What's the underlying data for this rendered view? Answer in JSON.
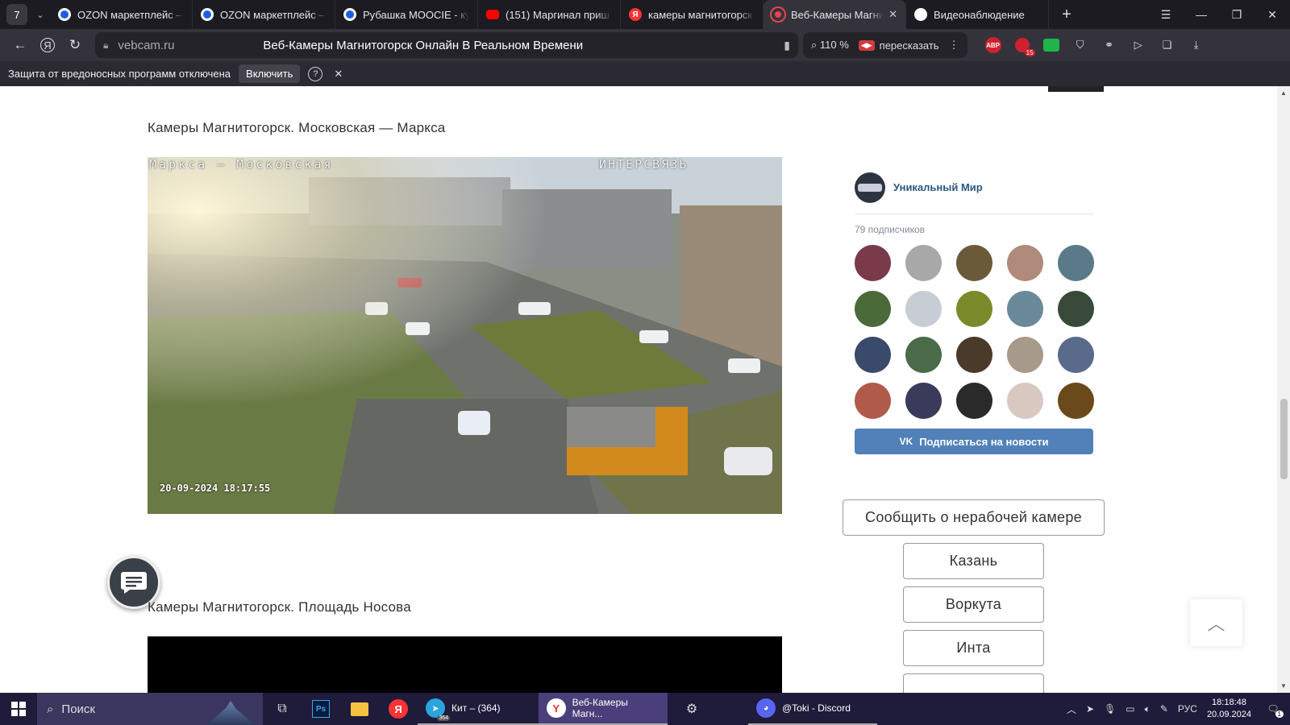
{
  "browser": {
    "tab_count": "7",
    "tabs": [
      {
        "title": "OZON маркетплейс – ",
        "color": "#1b5fde"
      },
      {
        "title": "OZON маркетплейс – ",
        "color": "#1b5fde"
      },
      {
        "title": "Рубашка MOOCIE - куп",
        "color": "#1b5fde"
      },
      {
        "title": "(151) Маргинал приш",
        "color": "#ff0000"
      },
      {
        "title": "камеры магнитогорск",
        "color": "#f33"
      },
      {
        "title": "Веб-Камеры Магни",
        "color": "#e8434c",
        "active": true
      },
      {
        "title": "Видеонаблюдение",
        "color": "#ffffff"
      }
    ],
    "domain": "vebcam.ru",
    "page_title": "Веб-Камеры Магнитогорск Онлайн В Реальном Времени",
    "zoom": "110 %",
    "retell_label": "пересказать",
    "ext_abp": "ABP",
    "ext_badge": "15"
  },
  "infobar": {
    "message": "Защита от вредоносных программ отключена",
    "enable_label": "Включить"
  },
  "content": {
    "cam1_title": "Камеры Магнитогорск. Московская — Маркса",
    "cam1_caption_left": "Маркса – Московская",
    "cam1_caption_right": "ИНТЕРСВЯЗЬ",
    "cam1_timestamp": "20-09-2024 18:17:55",
    "cam2_title": "Камеры Магнитогорск. Площадь Носова"
  },
  "vk_widget": {
    "group_name": "Уникальный Мир",
    "subscribers": "79 подписчиков",
    "subscribe_label": "Подписаться на новости",
    "vk_logo": "VK",
    "avatar_colors": [
      "#7a3a4a",
      "#a8a8a8",
      "#6b5a3a",
      "#b08a7a",
      "#5a7a8a",
      "#4a6a3a",
      "#c8ccd4",
      "#7a8a2a",
      "#6a8a9a",
      "#3a4a3a",
      "#3a4a6a",
      "#4a6a4a",
      "#4a3a2a",
      "#a89a8a",
      "#5a6a8a",
      "#b05a4a",
      "#3a3a5a",
      "#2a2a2a",
      "#d8c8c0",
      "#6a4a1a"
    ]
  },
  "sidebar": {
    "report_label": "Сообщить о нерабочей камере",
    "cities": [
      "Казань",
      "Воркута",
      "Инта"
    ]
  },
  "taskbar": {
    "search_label": "Поиск",
    "apps": [
      {
        "label": "Кит – (364)",
        "icon": "telegram-icon",
        "badge": "364"
      },
      {
        "label": "Веб-Камеры Магн...",
        "icon": "yandex-browser-icon",
        "active": true
      },
      {
        "label": "@Toki - Discord",
        "icon": "discord-icon"
      }
    ],
    "language": "РУС",
    "time": "18:18:48",
    "date": "20.09.2024",
    "notif_count": "1"
  }
}
